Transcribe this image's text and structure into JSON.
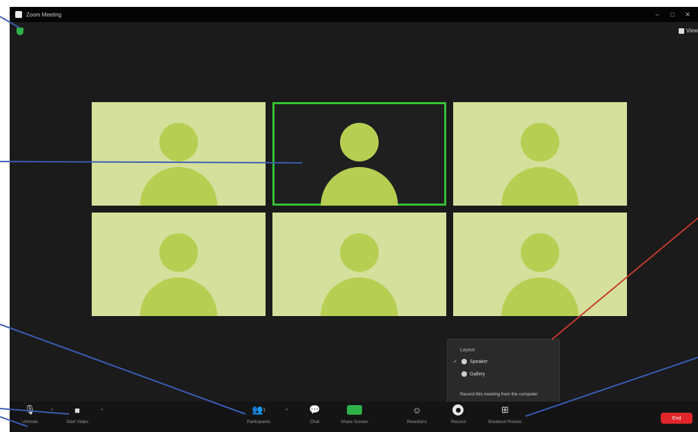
{
  "window": {
    "title": "Zoom Meeting",
    "controls": [
      "–",
      "□",
      "✕"
    ],
    "view_label": "View"
  },
  "participants": [
    {
      "state": "inactive"
    },
    {
      "state": "active-speaker"
    },
    {
      "state": "inactive"
    },
    {
      "state": "inactive"
    },
    {
      "state": "inactive"
    },
    {
      "state": "inactive"
    }
  ],
  "record_menu": {
    "title": "Layout",
    "options": [
      "Speaker",
      "Gallery"
    ],
    "selected": "Speaker",
    "footer": "Record this meeting from the computer"
  },
  "toolbar": {
    "unmute": "Unmute",
    "start_video": "Start Video",
    "participants": "Participants",
    "participants_count": "1",
    "chat": "Chat",
    "share_screen": "Share Screen",
    "reactions": "Reactions",
    "record": "Record",
    "more": "Breakout Rooms",
    "end": "End"
  },
  "colors": {
    "tile_bg": "#d5e09c",
    "avatar": "#b6cf52",
    "active_border": "#36c435",
    "end_button": "#e0262a",
    "share_green": "#2fb14a"
  }
}
